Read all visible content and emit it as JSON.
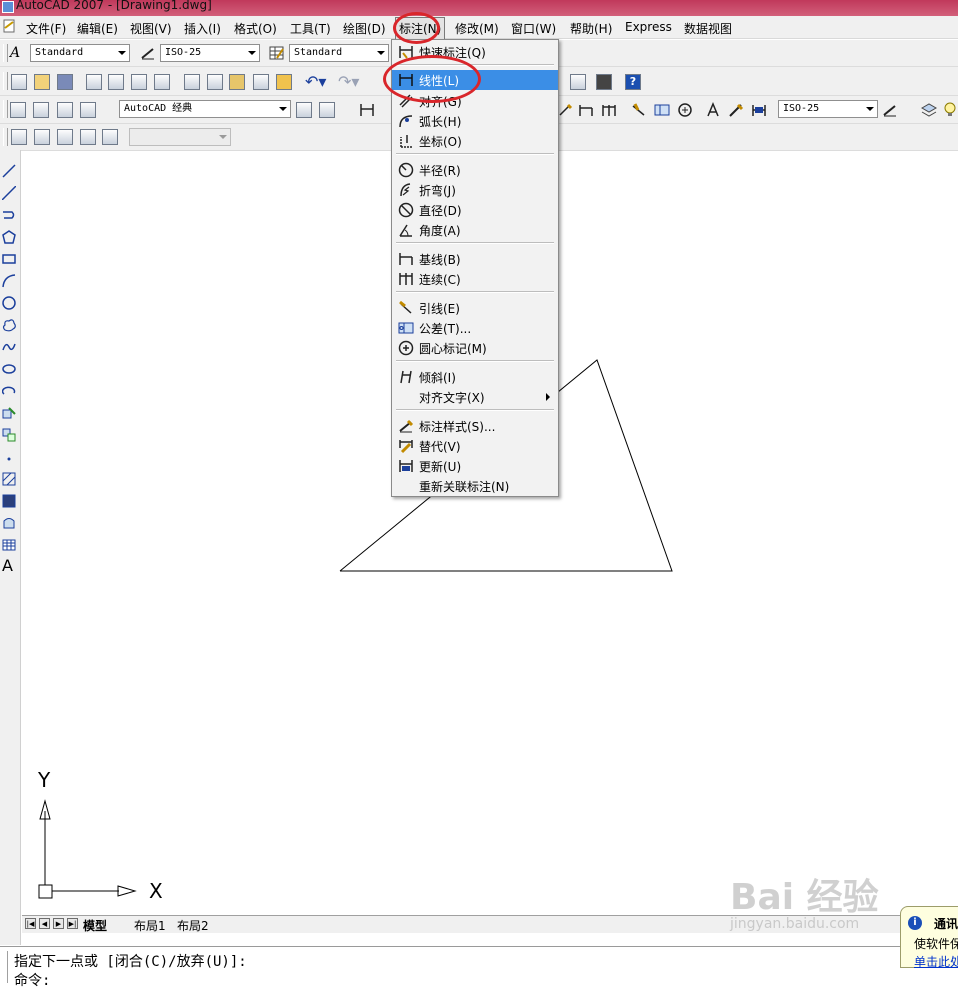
{
  "window": {
    "title": "AutoCAD 2007 - [Drawing1.dwg]"
  },
  "menubar": {
    "items": [
      "文件(F)",
      "编辑(E)",
      "视图(V)",
      "插入(I)",
      "格式(O)",
      "工具(T)",
      "绘图(D)",
      "标注(N)",
      "修改(M)",
      "窗口(W)",
      "帮助(H)",
      "Express",
      "数据视图"
    ],
    "active": "标注(N)"
  },
  "styles_toolbar": {
    "text_style": "Standard",
    "dim_style": "ISO-25",
    "table_style": "Standard"
  },
  "workspace_toolbar": {
    "workspace": "AutoCAD 经典",
    "dim_style_right": "ISO-25"
  },
  "dimension_menu": {
    "items": [
      {
        "label": "快速标注(Q)",
        "icon": "quick-dimension-icon"
      },
      {
        "label": "线性(L)",
        "icon": "linear-dimension-icon",
        "highlighted": true
      },
      {
        "label": "对齐(G)",
        "icon": "aligned-dimension-icon"
      },
      {
        "label": "弧长(H)",
        "icon": "arc-length-icon"
      },
      {
        "label": "坐标(O)",
        "icon": "ordinate-icon"
      },
      {
        "label": "半径(R)",
        "icon": "radius-icon"
      },
      {
        "label": "折弯(J)",
        "icon": "jogged-icon"
      },
      {
        "label": "直径(D)",
        "icon": "diameter-icon"
      },
      {
        "label": "角度(A)",
        "icon": "angular-icon"
      },
      {
        "label": "基线(B)",
        "icon": "baseline-icon"
      },
      {
        "label": "连续(C)",
        "icon": "continue-icon"
      },
      {
        "label": "引线(E)",
        "icon": "leader-icon"
      },
      {
        "label": "公差(T)...",
        "icon": "tolerance-icon"
      },
      {
        "label": "圆心标记(M)",
        "icon": "center-mark-icon"
      },
      {
        "label": "倾斜(I)",
        "icon": "oblique-icon"
      },
      {
        "label": "对齐文字(X)",
        "icon": "",
        "submenu": true
      },
      {
        "label": "标注样式(S)...",
        "icon": "dimension-style-icon"
      },
      {
        "label": "替代(V)",
        "icon": "override-icon"
      },
      {
        "label": "更新(U)",
        "icon": "update-icon"
      },
      {
        "label": "重新关联标注(N)",
        "icon": ""
      }
    ]
  },
  "ucs": {
    "x_label": "X",
    "y_label": "Y"
  },
  "layout_tabs": [
    "模型",
    "布局1",
    "布局2"
  ],
  "command_line": {
    "line1": "指定下一点或 [闭合(C)/放弃(U)]:",
    "line2": "命令:"
  },
  "notification": {
    "title": "通讯",
    "body": "使软件保",
    "link": "单击此处"
  },
  "watermark": {
    "text": "Bai 经验",
    "sub": "jingyan.baidu.com"
  },
  "colors": {
    "highlight": "#3b8ee6",
    "annotation_circle": "#d9262b",
    "title_bar": "#c0395b"
  }
}
